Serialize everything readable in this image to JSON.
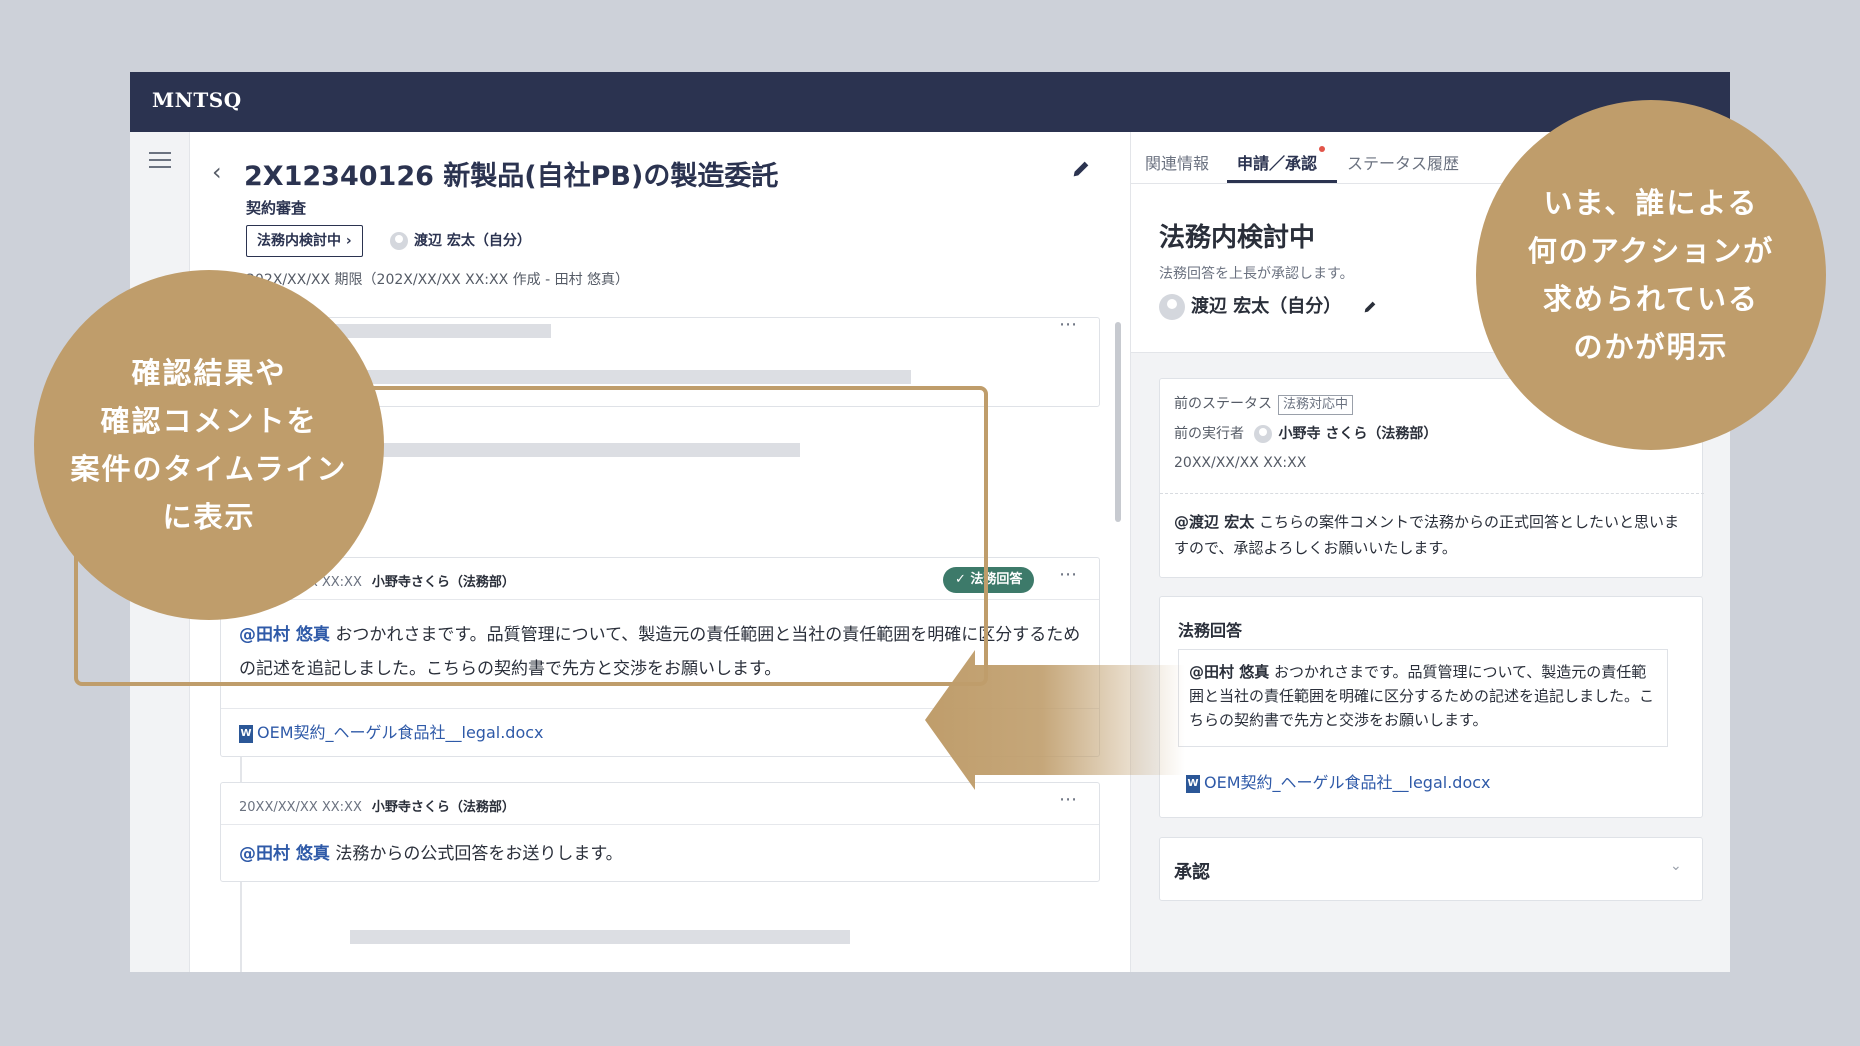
{
  "app": {
    "logo": "MNTSQ"
  },
  "header": {
    "title": "2X12340126 新製品(自社PB)の製造委託",
    "subtitle": "契約審査",
    "status_pill": "法務内検討中 ›",
    "assignee": "渡辺 宏太（自分）",
    "deadline": "202X/XX/XX 期限（202X/XX/XX XX:XX 作成 - 田村 悠真）"
  },
  "timeline": {
    "card1": {
      "time": "20XX/XX/XX XX:XX",
      "author": "小野寺さくら（法務部）",
      "badge": "✓ 法務回答",
      "mention": "@田村 悠真",
      "body": " おつかれさまです。品質管理について、製造元の責任範囲と当社の責任範囲を明確に区分するための記述を追記しました。こちらの契約書で先方と交渉をお願いします。",
      "attachment": "OEM契約_ヘーゲル食品社__legal.docx"
    },
    "card2": {
      "time": "20XX/XX/XX XX:XX",
      "author": "小野寺さくら（法務部）",
      "mention": "@田村 悠真",
      "body": " 法務からの公式回答をお送りします。"
    }
  },
  "right_panel": {
    "tabs": [
      "関連情報",
      "申請／承認",
      "ステータス履歴"
    ],
    "status": "法務内検討中",
    "desc": "法務回答を上長が承認します。",
    "assignee": "渡辺 宏太（自分）",
    "prev": {
      "status_label": "前のステータス",
      "status_tag": "法務対応中",
      "actor_label": "前の実行者",
      "actor": "小野寺 さくら（法務部）",
      "time": "20XX/XX/XX XX:XX",
      "mention": "@渡辺 宏太",
      "comment": " こちらの案件コメントで法務からの正式回答としたいと思いますので、承認よろしくお願いいたします。"
    },
    "legal": {
      "title": "法務回答",
      "mention": "@田村 悠真",
      "body": " おつかれさまです。品質管理について、製造元の責任範囲と当社の責任範囲を明確に区分するための記述を追記しました。こちらの契約書で先方と交渉をお願いします。",
      "attachment": "OEM契約_ヘーゲル食品社__legal.docx"
    },
    "approve": {
      "title": "承認"
    }
  },
  "callouts": {
    "left": "確認結果や\n確認コメントを\n案件のタイムライン\nに表示",
    "right": "いま、誰による\n何のアクションが\n求められている\nのかが明示"
  },
  "colors": {
    "navy": "#2b3350",
    "gold": "#bf9d6b",
    "teal": "#3d7a6a",
    "link": "#2f5aa8"
  }
}
